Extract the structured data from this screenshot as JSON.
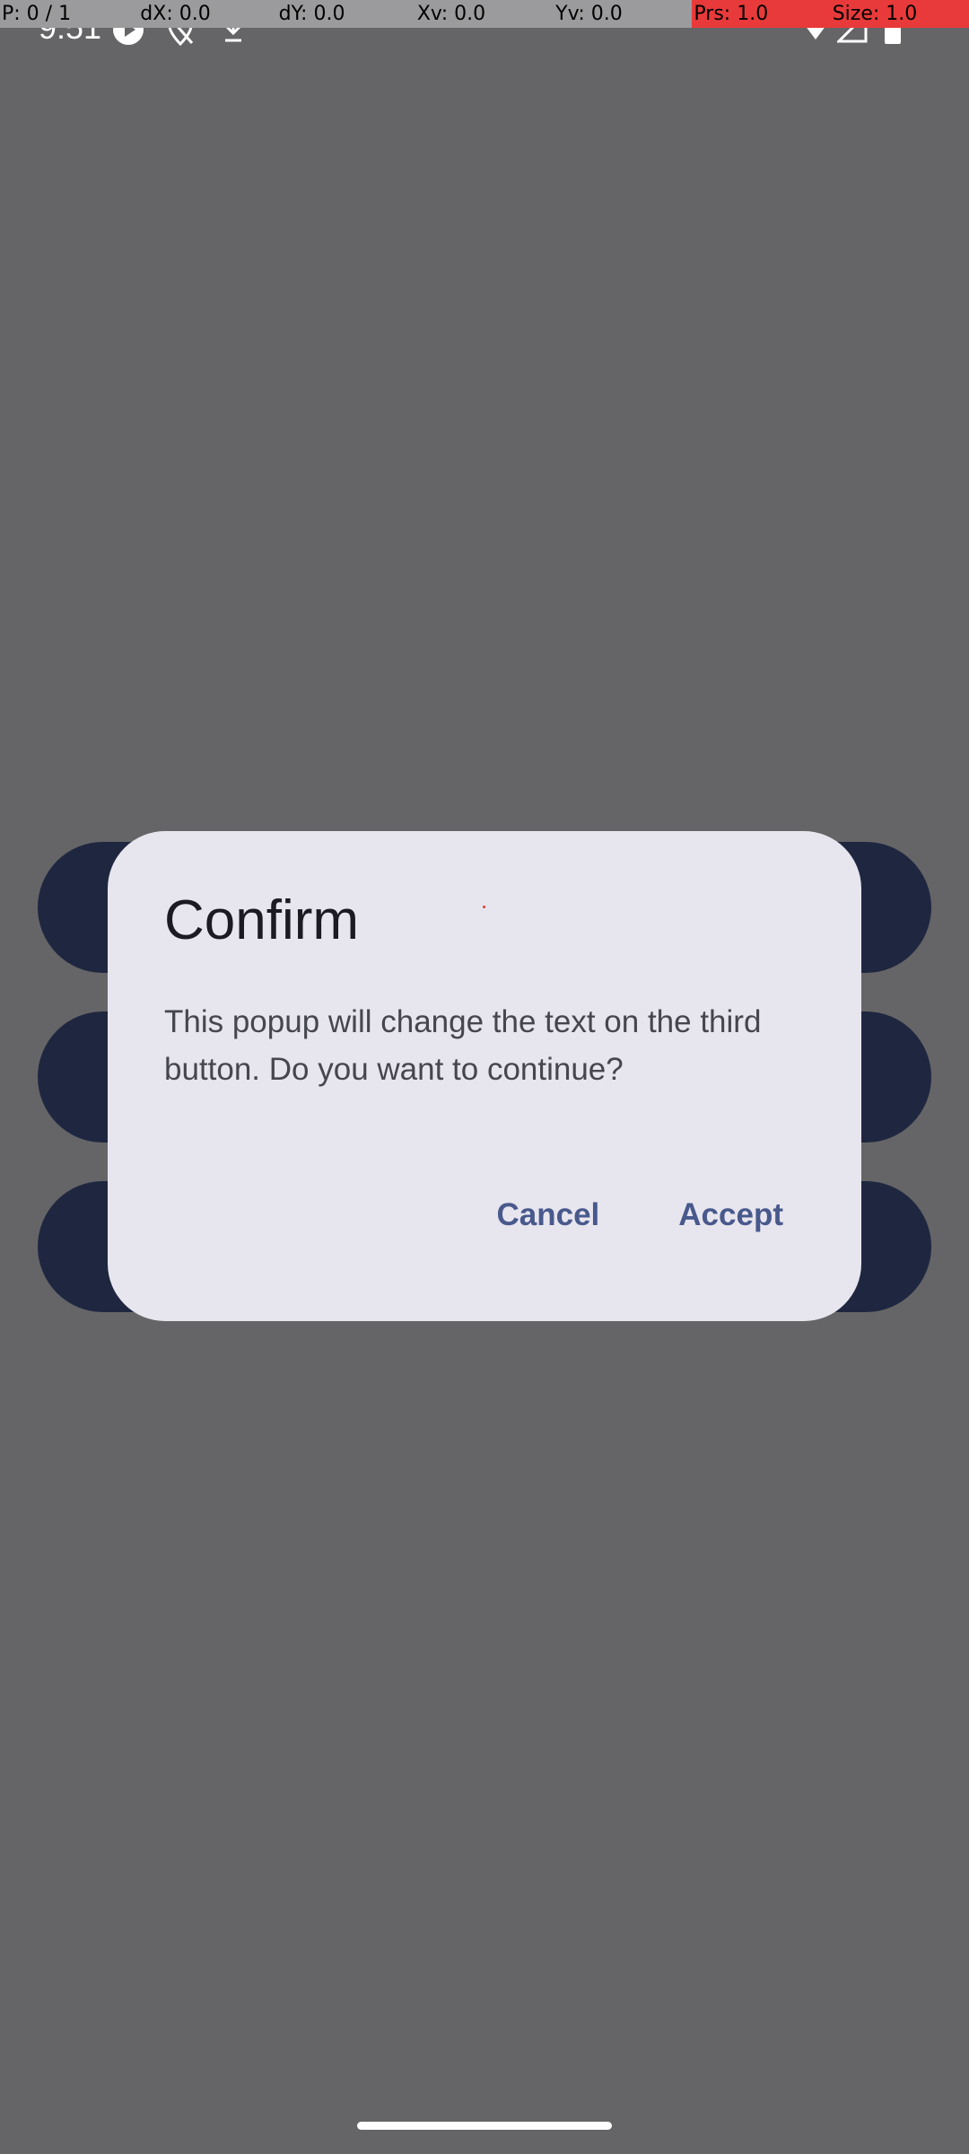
{
  "debug_overlay": {
    "cells": [
      {
        "text": "P: 0 / 1",
        "highlight": false
      },
      {
        "text": "dX: 0.0",
        "highlight": false
      },
      {
        "text": "dY: 0.0",
        "highlight": false
      },
      {
        "text": "Xv: 0.0",
        "highlight": false
      },
      {
        "text": "Yv: 0.0",
        "highlight": false
      },
      {
        "text": "Prs: 1.0",
        "highlight": true
      },
      {
        "text": "Size: 1.0",
        "highlight": true
      }
    ]
  },
  "status_bar": {
    "time": "9:51",
    "icons": [
      "media-play-icon",
      "location-off-icon",
      "download-icon",
      "wifi-icon",
      "signal-icon",
      "battery-icon"
    ]
  },
  "dialog": {
    "title": "Confirm",
    "message": "This popup will change the text on the third button. Do you want to continue?",
    "cancel_label": "Cancel",
    "accept_label": "Accept"
  },
  "colors": {
    "scrim": "#656567",
    "dialog_surface": "#e7e5ee",
    "button_text": "#48598c",
    "background_buttons": "#1f2740"
  }
}
